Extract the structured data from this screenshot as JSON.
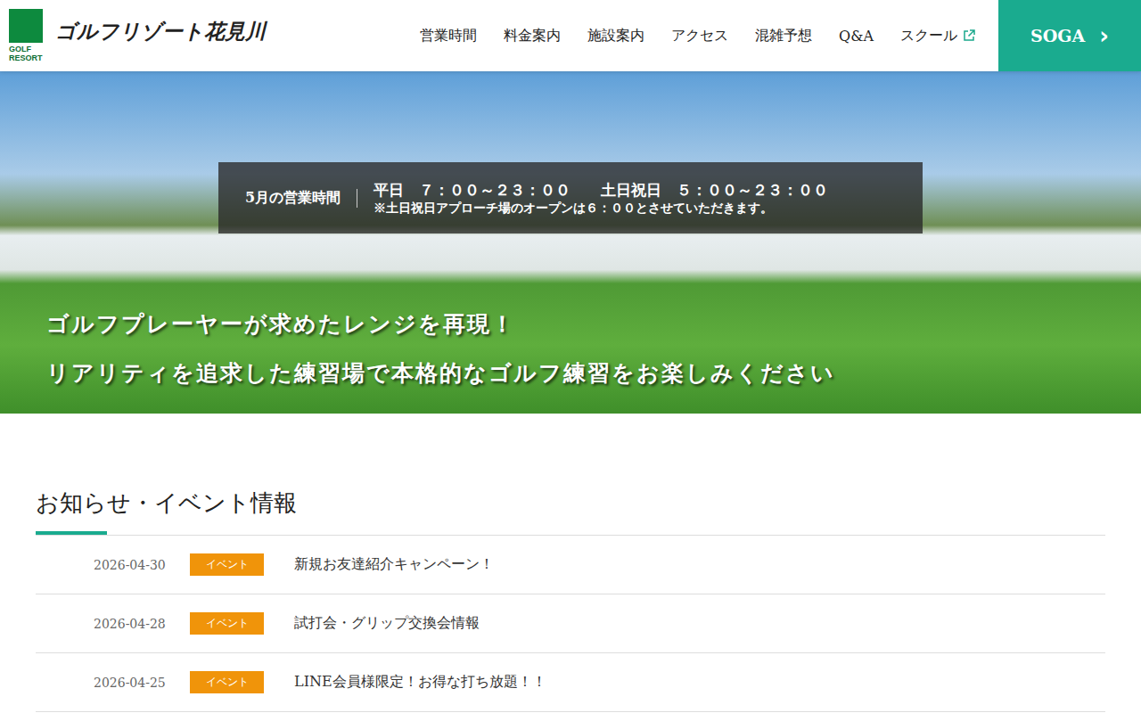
{
  "logo": {
    "mark_text": [
      "GOLF",
      "RESORT"
    ],
    "name": "ゴルフリゾート花見川"
  },
  "nav": [
    {
      "label": "営業時間",
      "external": false
    },
    {
      "label": "料金案内",
      "external": false
    },
    {
      "label": "施設案内",
      "external": false
    },
    {
      "label": "アクセス",
      "external": false
    },
    {
      "label": "混雑予想",
      "external": false
    },
    {
      "label": "Q&A",
      "external": false
    },
    {
      "label": "スクール",
      "external": true
    }
  ],
  "soga_button": {
    "label": "SOGA",
    "icon": "›"
  },
  "hero": {
    "hours_label": "5月の営業時間",
    "hours_lines": [
      "平日　７：００～２３：００　　土日祝日　５：００～２３：００",
      "※土日祝日アプローチ場のオープンは６：００とさせていただきます。"
    ],
    "slogans": [
      "ゴルフプレーヤーが求めたレンジを再現！",
      "リアリティを追求した練習場で本格的なゴルフ練習をお楽しみください"
    ]
  },
  "news": {
    "title": "お知らせ・イベント情報",
    "items": [
      {
        "date": "2026-04-30",
        "tag": "イベント",
        "title": "新規お友達紹介キャンペーン！"
      },
      {
        "date": "2026-04-28",
        "tag": "イベント",
        "title": "試打会・グリップ交換会情報"
      },
      {
        "date": "2026-04-25",
        "tag": "イベント",
        "title": "LINE会員様限定！お得な打ち放題！！"
      }
    ]
  }
}
